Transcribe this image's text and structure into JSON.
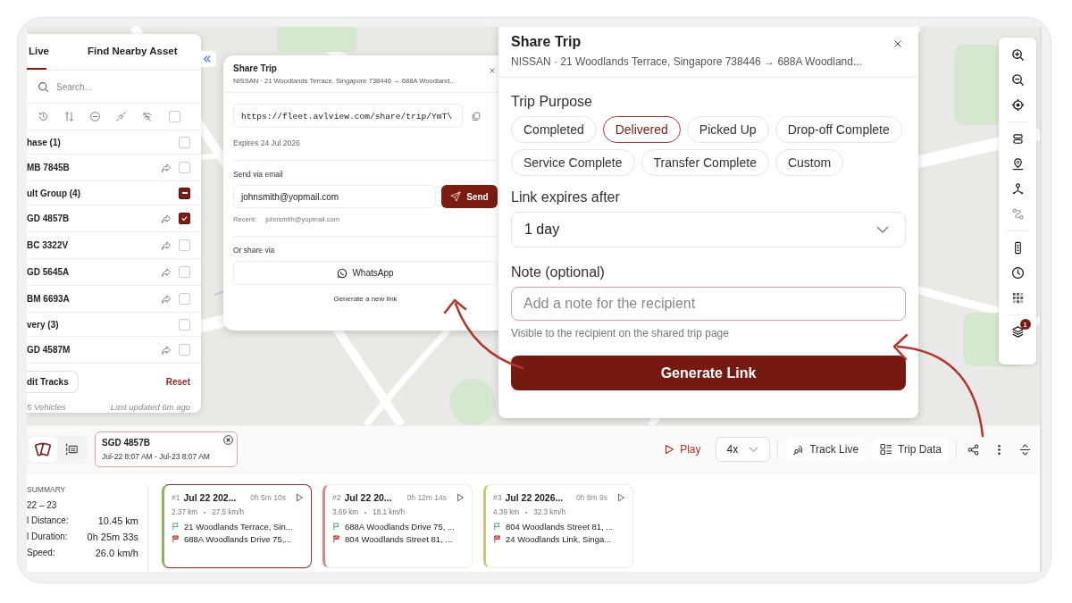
{
  "left_panel": {
    "tabs": [
      {
        "label": "Live",
        "selected": true
      },
      {
        "label": "Find Nearby Asset",
        "selected": false
      }
    ],
    "search": {
      "placeholder": "Search..."
    },
    "select_all": {
      "checked": false
    },
    "groups": [
      {
        "name": "hase (1)",
        "indeterminate": false,
        "vehicles": [
          {
            "plate": "MB 7845B",
            "checked": false
          }
        ]
      },
      {
        "name": "ult Group (4)",
        "indeterminate": true,
        "vehicles": [
          {
            "plate": "GD 4857B",
            "checked": true
          },
          {
            "plate": "BC 3322V",
            "checked": false
          },
          {
            "plate": "GD 5645A",
            "checked": false
          },
          {
            "plate": "BM 6693A",
            "checked": false
          }
        ]
      },
      {
        "name": "very (3)",
        "indeterminate": false,
        "vehicles": [
          {
            "plate": "GD 4587M",
            "checked": false
          }
        ]
      }
    ],
    "edit_button": "dit Tracks",
    "reset": "Reset",
    "count": "5 Vehicles",
    "updated": "Last updated 6m ago"
  },
  "share_popup": {
    "title": "Share Trip",
    "subtitle": "NISSAN · 21 Woodlands Terrace, Singapore 738446 → 688A Woodland...",
    "link": "https://fleet.avlview.com/share/trip/YmT\\",
    "expires": "Expires 24 Jul 2026",
    "email_label": "Send via email",
    "email_value": "johnsmith@yopmail.com",
    "send": "Send",
    "recent_label": "Recent:",
    "recent_value": "johnsmith@yopmail.com",
    "or_share": "Or share via",
    "whatsapp": "WhatsApp",
    "regenerate": "Generate a new link"
  },
  "share_panel": {
    "title": "Share Trip",
    "subtitle": "NISSAN · 21 Woodlands Terrace, Singapore 738446 → 688A Woodland...",
    "purpose_label": "Trip Purpose",
    "purposes": [
      {
        "label": "Completed",
        "selected": false
      },
      {
        "label": "Delivered",
        "selected": true
      },
      {
        "label": "Picked Up",
        "selected": false
      },
      {
        "label": "Drop-off Complete",
        "selected": false
      },
      {
        "label": "Service Complete",
        "selected": false
      },
      {
        "label": "Transfer Complete",
        "selected": false
      },
      {
        "label": "Custom",
        "selected": false
      }
    ],
    "expiry_label": "Link expires after",
    "expiry_value": "1 day",
    "note_label": "Note (optional)",
    "note_placeholder": "Add a note for the recipient",
    "note_hint": "Visible to the recipient on the shared trip page",
    "generate": "Generate Link"
  },
  "map_toolbar": {
    "layers_badge": "1"
  },
  "playback": {
    "chip": {
      "plate": "SGD 4857B",
      "range": "Jul-22 8:07 AM - Jul-23 8:07 AM"
    },
    "play": "Play",
    "speed": "4x",
    "track_live": "Track Live",
    "trip_data": "Trip Data"
  },
  "summary": {
    "heading": "SUMMARY",
    "dates": "22 – 23",
    "rows": [
      {
        "label": "l Distance:",
        "value": "10.45 km"
      },
      {
        "label": "l Duration:",
        "value": "0h 25m 33s"
      },
      {
        "label": "Speed:",
        "value": "26.0 km/h"
      }
    ]
  },
  "trips": [
    {
      "index": "#1",
      "date": "Jul 22 202...",
      "duration": "0h 5m 10s",
      "distance": "2.37 km",
      "speed": "27.5 km/h",
      "from": "21 Woodlands Terrace, Sin...",
      "to": "688A Woodlands Drive 75,...",
      "color": "#8fb35c",
      "selected": true
    },
    {
      "index": "#2",
      "date": "Jul 22 20...",
      "duration": "0h 12m 14s",
      "distance": "3.69 km",
      "speed": "18.1 km/h",
      "from": "688A Woodlands Drive 75, ...",
      "to": "804 Woodlands Street 81, ...",
      "color": "#d98585",
      "selected": false
    },
    {
      "index": "#3",
      "date": "Jul 22 2026...",
      "duration": "0h 8m 9s",
      "distance": "4.39 km",
      "speed": "32.3 km/h",
      "from": "804 Woodlands Street 81, ...",
      "to": "24 Woodlands Link, Singa...",
      "color": "#c8c77e",
      "selected": false
    }
  ]
}
